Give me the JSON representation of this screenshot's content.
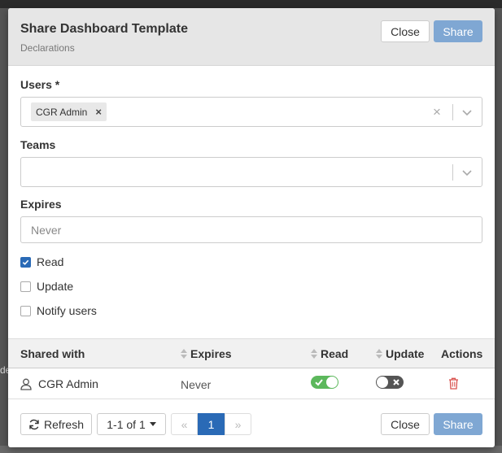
{
  "background": {
    "partial_text": "de"
  },
  "modal": {
    "title": "Share Dashboard Template",
    "subtitle": "Declarations",
    "header_close_label": "Close",
    "header_share_label": "Share"
  },
  "form": {
    "users_label": "Users *",
    "users_selected": [
      "CGR Admin"
    ],
    "teams_label": "Teams",
    "expires_label": "Expires",
    "expires_placeholder": "Never",
    "checkboxes": [
      {
        "label": "Read",
        "checked": true
      },
      {
        "label": "Update",
        "checked": false
      },
      {
        "label": "Notify users",
        "checked": false
      }
    ]
  },
  "table": {
    "columns": [
      "Shared with",
      "Expires",
      "Read",
      "Update",
      "Actions"
    ],
    "rows": [
      {
        "shared_with": "CGR Admin",
        "expires": "Never",
        "read": true,
        "update": false
      }
    ]
  },
  "footer": {
    "refresh_label": "Refresh",
    "page_size_label": "1-1 of 1",
    "first_page_label": "«",
    "current_page": "1",
    "last_page_label": "»",
    "close_label": "Close",
    "share_label": "Share"
  },
  "colors": {
    "primary_disabled": "#7fa7d3",
    "primary": "#2a6ab6",
    "toggle_on": "#5cb85c",
    "toggle_off": "#555555",
    "delete": "#d9534f"
  },
  "icons": {
    "tag_remove": "×",
    "clear": "close-icon",
    "dropdown": "chevron-down-icon",
    "user": "user-icon",
    "delete": "trash-icon",
    "refresh": "refresh-icon"
  }
}
